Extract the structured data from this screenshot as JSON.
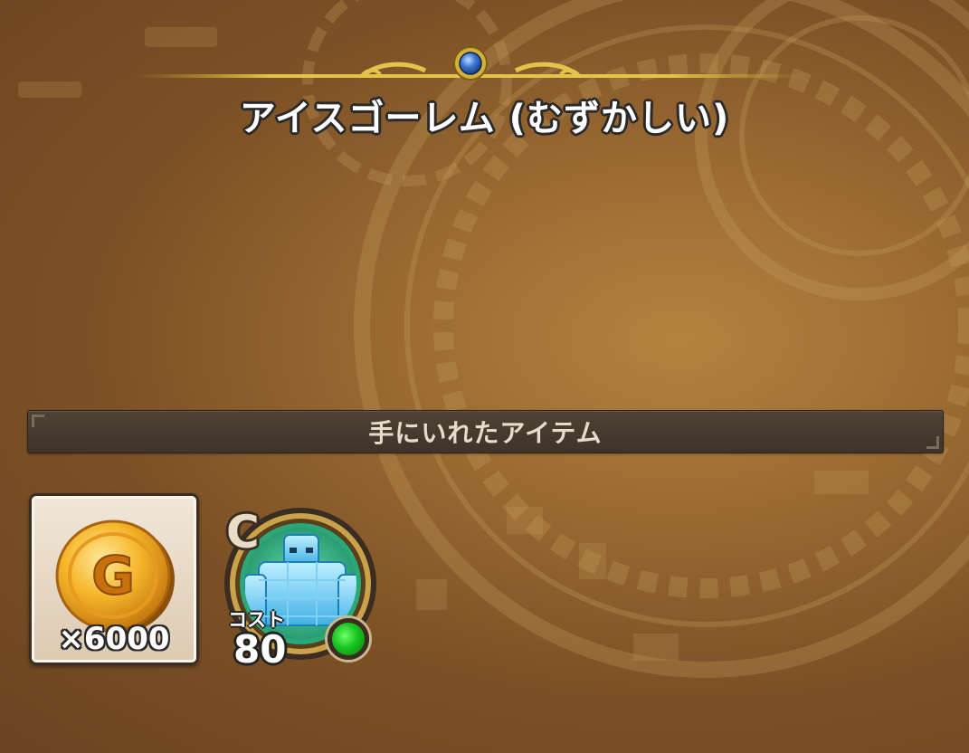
{
  "stage": {
    "title": "アイスゴーレム (むずかしい)"
  },
  "rewards": {
    "header": "手にいれたアイテム",
    "gold": {
      "icon": "gold-coin-icon",
      "coin_letter": "G",
      "quantity_text": "×6000"
    },
    "monster": {
      "icon": "ice-golem-portrait-icon",
      "rank": "C",
      "cost_label": "コスト",
      "cost_value": "80",
      "status_color": "#18c41e"
    }
  },
  "colors": {
    "background": "#9a6a32",
    "header_bar": "#463a2f",
    "gem": "#3f7bd6",
    "ornament_gold": "#c9a62b"
  }
}
